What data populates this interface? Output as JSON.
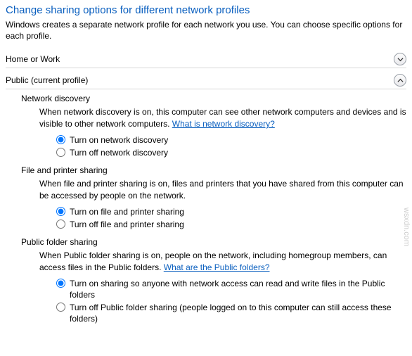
{
  "title": "Change sharing options for different network profiles",
  "subtitle": "Windows creates a separate network profile for each network you use. You can choose specific options for each profile.",
  "sections": {
    "home": {
      "label": "Home or Work"
    },
    "public": {
      "label": "Public (current profile)"
    }
  },
  "network_discovery": {
    "heading": "Network discovery",
    "desc_a": "When network discovery is on, this computer can see other network computers and devices and is visible to other network computers. ",
    "link": "What is network discovery?",
    "opt_on": "Turn on network discovery",
    "opt_off": "Turn off network discovery"
  },
  "file_printer": {
    "heading": "File and printer sharing",
    "desc": "When file and printer sharing is on, files and printers that you have shared from this computer can be accessed by people on the network.",
    "opt_on": "Turn on file and printer sharing",
    "opt_off": "Turn off file and printer sharing"
  },
  "public_folder": {
    "heading": "Public folder sharing",
    "desc_a": "When Public folder sharing is on, people on the network, including homegroup members, can access files in the Public folders. ",
    "link": "What are the Public folders?",
    "opt_on": "Turn on sharing so anyone with network access can read and write files in the Public folders",
    "opt_off": "Turn off Public folder sharing (people logged on to this computer can still access these folders)"
  },
  "watermark": "wsxdn.com"
}
